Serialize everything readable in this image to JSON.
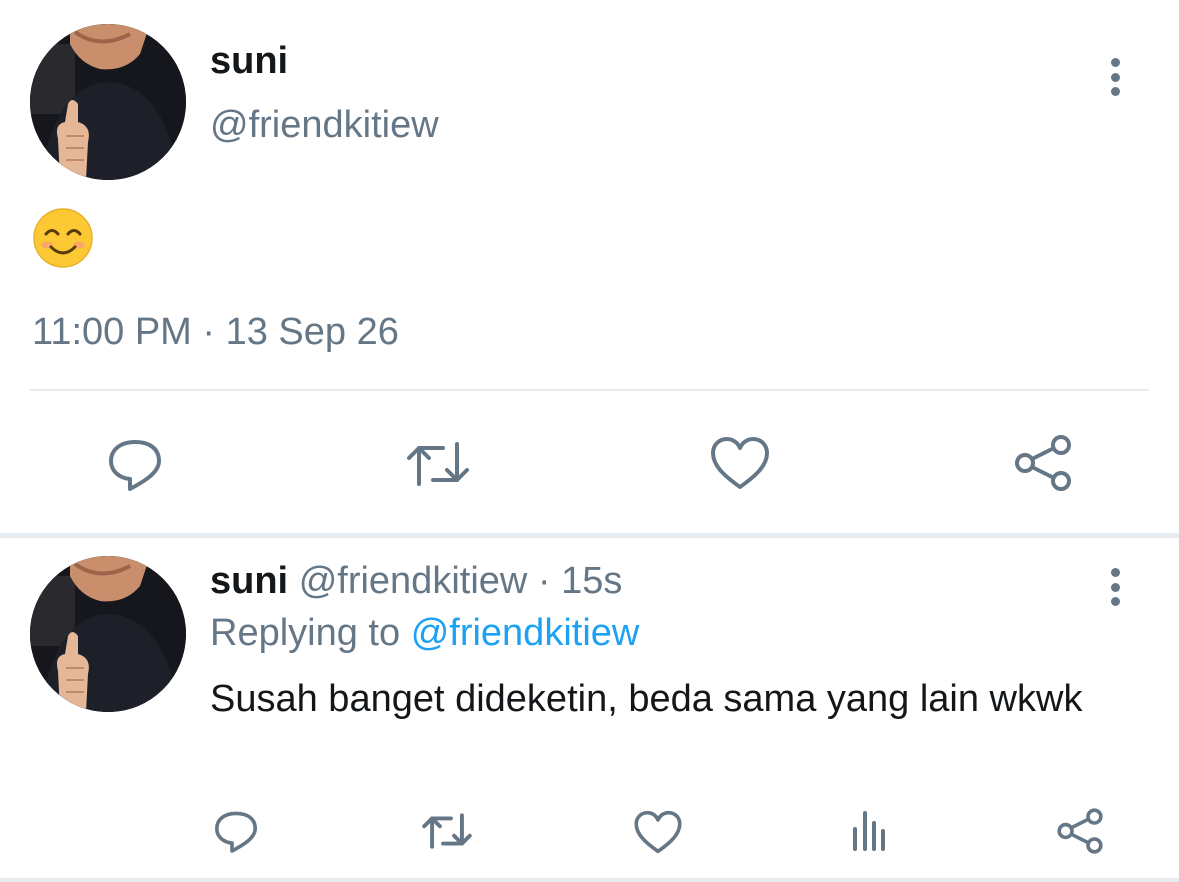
{
  "main_tweet": {
    "author": {
      "name": "suni",
      "handle": "@friendkitiew",
      "avatar_icon": "profile-photo-thumbs-up"
    },
    "content_emoji": "smiling-face-emoji",
    "timestamp": "11:00 PM · 13 Sep 26",
    "actions": [
      {
        "icon": "reply-icon"
      },
      {
        "icon": "retweet-icon"
      },
      {
        "icon": "like-icon"
      },
      {
        "icon": "share-icon"
      }
    ]
  },
  "reply_tweet": {
    "author": {
      "name": "suni",
      "handle": "@friendkitiew",
      "avatar_icon": "profile-photo-thumbs-up"
    },
    "separator": "·",
    "time": "15s",
    "replying_prefix": "Replying to",
    "replying_to": "@friendkitiew",
    "text": "Susah banget dideketin, beda sama yang lain wkwk",
    "actions": [
      {
        "icon": "reply-icon"
      },
      {
        "icon": "retweet-icon"
      },
      {
        "icon": "like-icon"
      },
      {
        "icon": "analytics-icon"
      },
      {
        "icon": "share-icon"
      }
    ]
  },
  "colors": {
    "text": "#14171a",
    "secondary": "#657786",
    "link": "#1da1f2",
    "divider": "#e6ecf0"
  }
}
